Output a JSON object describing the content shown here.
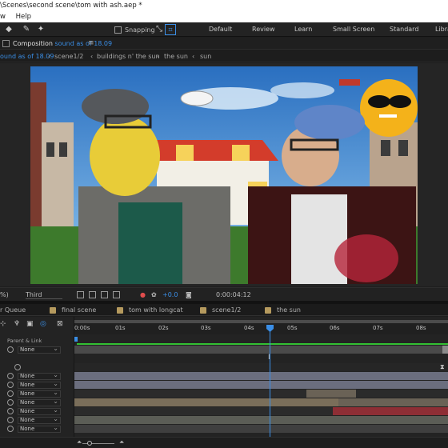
{
  "window": {
    "title": "\\Scenes\\second scene\\tom with ash.aep *"
  },
  "menu": {
    "items": [
      "w",
      "Help"
    ]
  },
  "toolbar": {
    "snapping_label": "Snapping",
    "workspaces": [
      "Default",
      "Review",
      "Learn",
      "Small Screen",
      "Standard",
      "Libra"
    ]
  },
  "composition": {
    "header_prefix": "Composition",
    "header_name": "sound as of 18.09",
    "breadcrumbs": [
      "ound as of 18.09",
      "scene1/2",
      "buildings n' the sun",
      "the sun",
      "sun"
    ]
  },
  "viewer_footer": {
    "zoom_glyph": "%)",
    "resolution": "Third",
    "exposure": "+0.0",
    "timecode": "0:00:04:12"
  },
  "timeline": {
    "tabs": [
      "r Queue",
      "final scene",
      "tom with longcat",
      "scene1/2",
      "the sun"
    ],
    "parent_label": "Parent & Link",
    "ruler_ticks": [
      "0:00s",
      "01s",
      "02s",
      "03s",
      "04s",
      "05s",
      "06s",
      "07s",
      "08s"
    ],
    "layer_parent_values": [
      "None",
      "None",
      "None",
      "None",
      "None",
      "None",
      "None",
      "None"
    ],
    "playhead_seconds": 4.5
  },
  "colors": {
    "accent": "#3a8ee6",
    "tab_swatch": "#b59a5e",
    "work_area_green": "#33c033",
    "track_grey": "#6b6e7e",
    "track_tan": "#7a6e5a",
    "track_red": "#8e2e35"
  }
}
